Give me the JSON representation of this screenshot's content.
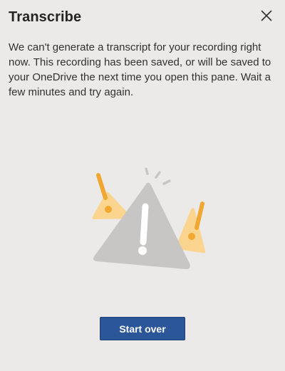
{
  "pane": {
    "title": "Transcribe",
    "close_icon": "close-icon"
  },
  "message": {
    "text": "We can't generate a transcript for your recording right now. This recording has been saved, or will be saved to your OneDrive the next time you open this pane. Wait a few minutes and try again."
  },
  "illustration": {
    "icon": "warning-triangle-illustration",
    "colors": {
      "main_triangle": "#c8c6c4",
      "small_triangles": "#fbd58f",
      "accent": "#f0a830",
      "background": "#ebeae9"
    }
  },
  "actions": {
    "start_over_label": "Start over",
    "button_color": "#2b579a"
  }
}
